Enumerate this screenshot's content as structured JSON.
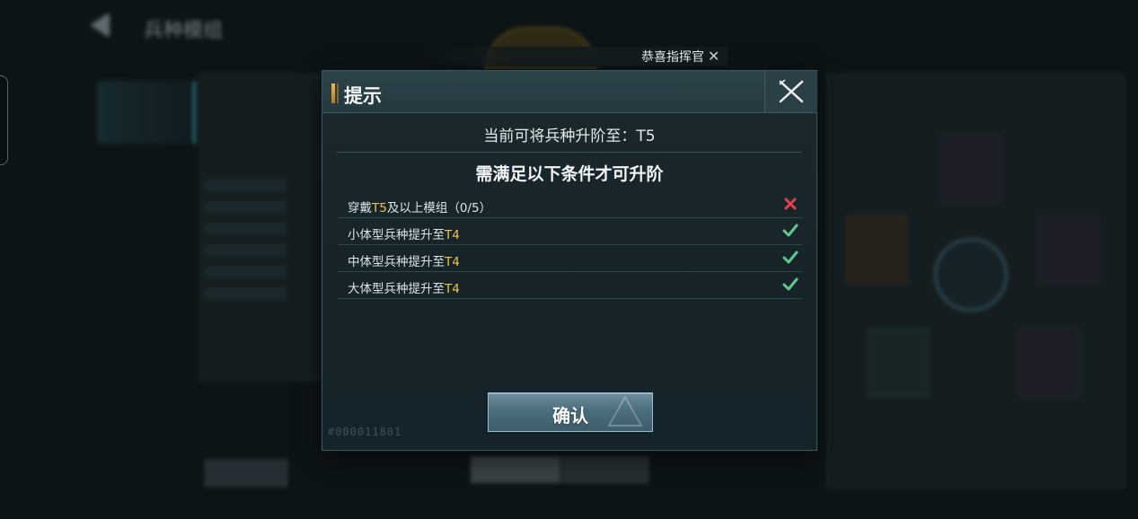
{
  "background": {
    "page_title": "兵种模组"
  },
  "toast": {
    "text": "恭喜指挥官",
    "close_glyph": "✕"
  },
  "dialog": {
    "title": "提示",
    "subtitle": "当前可将兵种升阶至：T5",
    "requirements_heading": "需满足以下条件才可升阶",
    "requirements": [
      {
        "prefix": "穿戴",
        "highlight": "T5",
        "suffix": "及以上模组（0/5）",
        "met": false
      },
      {
        "prefix": "小体型兵种提升至",
        "highlight": "T4",
        "suffix": "",
        "met": true
      },
      {
        "prefix": "中体型兵种提升至",
        "highlight": "T4",
        "suffix": "",
        "met": true
      },
      {
        "prefix": "大体型兵种提升至",
        "highlight": "T4",
        "suffix": "",
        "met": true
      }
    ],
    "confirm_label": "确认",
    "watermark": "#000011801"
  },
  "colors": {
    "highlight": "#f2c24a",
    "met": "#5fc98b",
    "unmet": "#e0434b",
    "accent": "#f0b84b"
  },
  "icons": {
    "close": "close-icon",
    "back": "back-arrow-icon",
    "met": "checkmark-icon",
    "unmet": "cross-icon"
  }
}
